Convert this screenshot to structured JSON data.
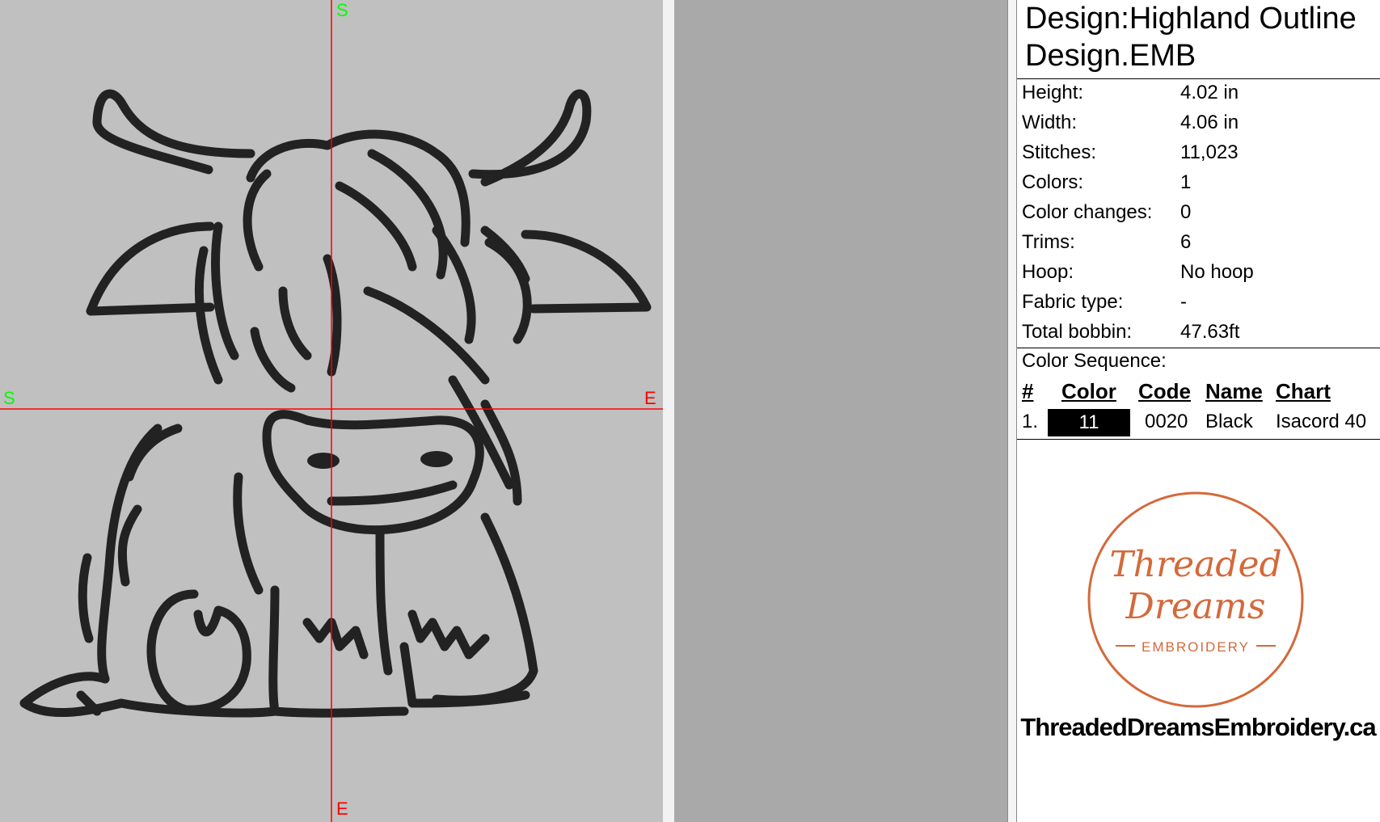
{
  "canvas": {
    "axis_top_label": "S",
    "axis_left_label": "S",
    "axis_right_label": "E",
    "axis_bottom_label": "E",
    "background_color": "#c0c0c0",
    "axis_color": "#ff0000",
    "start_label_color": "#00ff00",
    "end_label_color": "#ff0000",
    "stitch_color": "#000000"
  },
  "info": {
    "design_name": "Design:Highland Outline Design.EMB",
    "rows": [
      {
        "key": "Height:",
        "value": "4.02 in"
      },
      {
        "key": "Width:",
        "value": "4.06 in"
      },
      {
        "key": "Stitches:",
        "value": "11,023"
      },
      {
        "key": "Colors:",
        "value": "1"
      },
      {
        "key": "Color changes:",
        "value": "0"
      },
      {
        "key": "Trims:",
        "value": "6"
      },
      {
        "key": "Hoop:",
        "value": "No hoop"
      },
      {
        "key": "Fabric type:",
        "value": "-"
      },
      {
        "key": "Total bobbin:",
        "value": "47.63ft"
      }
    ]
  },
  "color_sequence": {
    "title": "Color Sequence:",
    "headers": {
      "num": "#",
      "color": "Color",
      "code": "Code",
      "name": "Name",
      "chart": "Chart"
    },
    "rows": [
      {
        "num": "1.",
        "color_label": "11",
        "swatch": "#000000",
        "code": "0020",
        "name": "Black",
        "chart": "Isacord 40"
      }
    ]
  },
  "branding": {
    "logo_line1": "Threaded",
    "logo_line2": "Dreams",
    "logo_line3": "EMBROIDERY",
    "logo_color": "#d4693a",
    "website": "ThreadedDreamsEmbroidery.ca"
  }
}
